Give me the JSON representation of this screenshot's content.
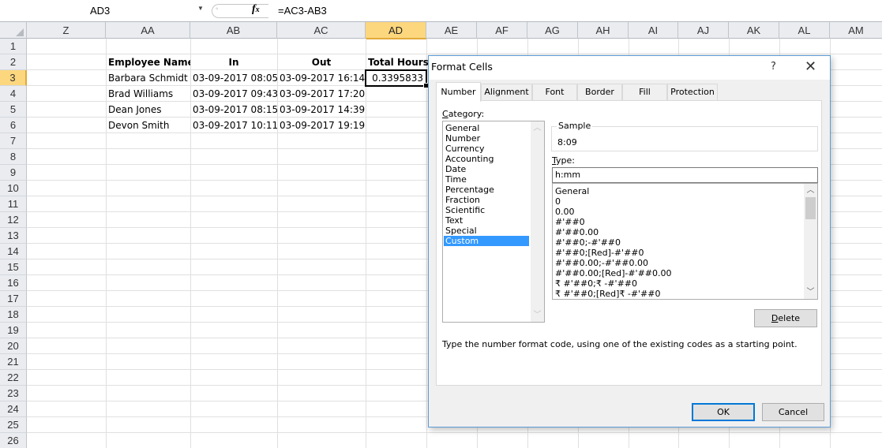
{
  "formula_bar": {
    "name_box": "AD3",
    "fx_label": "fx",
    "formula": "=AC3-AB3"
  },
  "columns": [
    "Z",
    "AA",
    "AB",
    "AC",
    "AD",
    "AE",
    "AF",
    "AG",
    "AH",
    "AI",
    "AJ",
    "AK",
    "AL",
    "AM"
  ],
  "selected_column": "AD",
  "row_numbers": [
    "1",
    "2",
    "3",
    "4",
    "5",
    "6",
    "7",
    "8",
    "9",
    "10",
    "11",
    "12",
    "13",
    "14",
    "15",
    "16",
    "17",
    "18",
    "19",
    "20",
    "21",
    "22",
    "23",
    "24",
    "25",
    "26"
  ],
  "selected_row": "3",
  "sheet": {
    "headers": {
      "employee_name": "Employee Name",
      "in": "In",
      "out": "Out",
      "total_hours": "Total Hours"
    },
    "rows": [
      {
        "name": "Barbara Schmidt",
        "in": "03-09-2017 08:05",
        "out": "03-09-2017 16:14",
        "total": "0.3395833"
      },
      {
        "name": "Brad Williams",
        "in": "03-09-2017 09:43",
        "out": "03-09-2017 17:20",
        "total": ""
      },
      {
        "name": "Dean Jones",
        "in": "03-09-2017 08:15",
        "out": "03-09-2017 14:39",
        "total": ""
      },
      {
        "name": "Devon Smith",
        "in": "03-09-2017 10:11",
        "out": "03-09-2017 19:19",
        "total": ""
      }
    ]
  },
  "dialog": {
    "title": "Format Cells",
    "help": "?",
    "close": "✕",
    "tabs": [
      "Number",
      "Alignment",
      "Font",
      "Border",
      "Fill",
      "Protection"
    ],
    "active_tab": "Number",
    "category_label_u": "C",
    "category_label_rest": "ategory:",
    "categories": [
      "General",
      "Number",
      "Currency",
      "Accounting",
      "Date",
      "Time",
      "Percentage",
      "Fraction",
      "Scientific",
      "Text",
      "Special",
      "Custom"
    ],
    "selected_category": "Custom",
    "sample_label": "Sample",
    "sample_value": "8:09",
    "type_label_u": "T",
    "type_label_rest": "ype:",
    "type_value": "h:mm",
    "type_list": [
      "General",
      "0",
      "0.00",
      "#'##0",
      "#'##0.00",
      "#'##0;-#'##0",
      "#'##0;[Red]-#'##0",
      "#'##0.00;-#'##0.00",
      "#'##0.00;[Red]-#'##0.00",
      "₹ #'##0;₹ -#'##0",
      "₹ #'##0;[Red]₹ -#'##0"
    ],
    "delete_u": "D",
    "delete_rest": "elete",
    "hint": "Type the number format code, using one of the existing codes as a starting point.",
    "ok": "OK",
    "cancel": "Cancel"
  }
}
